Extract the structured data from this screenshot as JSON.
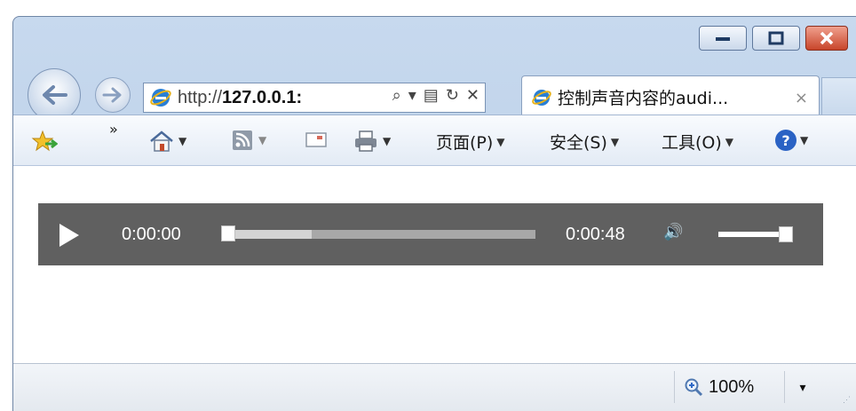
{
  "window": {
    "controls": {
      "minimize": "minimize",
      "maximize": "maximize",
      "close": "close"
    }
  },
  "address": {
    "url_prefix": "http://",
    "url_host": "127.0.0.1:",
    "search_glyph": "⌕",
    "dropdown_glyph": "▾",
    "compat_glyph": "▤",
    "refresh_glyph": "↻",
    "stop_glyph": "✕"
  },
  "tab": {
    "title": "控制声音内容的audi...",
    "close_glyph": "×"
  },
  "commandbar": {
    "chevron": "»",
    "page_label": "页面(P)",
    "safety_label": "安全(S)",
    "tools_label": "工具(O)",
    "help_glyph": "?"
  },
  "player": {
    "current_time": "0:00:00",
    "duration": "0:00:48",
    "buffered_fraction": 0.28,
    "progress_fraction": 0,
    "volume_fraction": 1.0,
    "volume_glyph": "🔊"
  },
  "statusbar": {
    "zoom_label": "100%",
    "zoom_dropdown": "▾"
  },
  "colors": {
    "player_bg": "#606060",
    "frame": "#c7d9ee",
    "close_button": "#c8452a"
  }
}
